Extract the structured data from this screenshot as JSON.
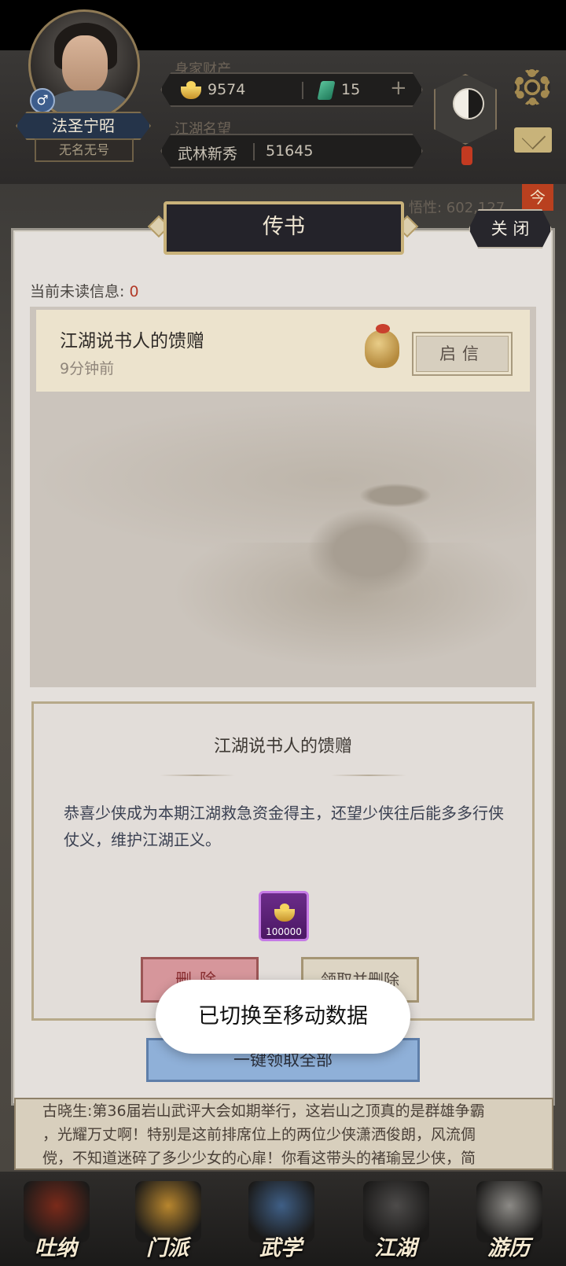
{
  "header": {
    "player_name": "法圣宁昭",
    "player_title": "无名无号",
    "gender_symbol": "♂",
    "wealth_label": "身家财产",
    "gold": "9574",
    "jade": "15",
    "plus_symbol": "+",
    "reputation_label": "江湖名望",
    "rank": "武林新秀",
    "reputation_value": "51645",
    "wuxing_text": "悟性: 602,127",
    "corner_badge": "今"
  },
  "modal": {
    "title": "传书",
    "close_label": "关 闭",
    "unread_label": "当前未读信息:",
    "unread_count": "0",
    "mail_items": [
      {
        "title": "江湖说书人的馈赠",
        "time": "9分钟前",
        "open_label": "启信"
      }
    ],
    "detail": {
      "title": "江湖说书人的馈赠",
      "body": "恭喜少侠成为本期江湖救急资金得主，还望少侠往后能多多行侠仗义，维护江湖正义。",
      "reward_amount": "100000",
      "delete_label": "删除",
      "claim_label": "领取并删除"
    },
    "claim_all_label": "一键领取全部"
  },
  "toast": "已切换至移动数据",
  "news": {
    "line1": "古晓生:第36届岩山武评大会如期举行，这岩山之顶真的是群雄争霸",
    "line2": "，光耀万丈啊！特别是这前排席位上的两位少侠潇洒俊朗，风流倜",
    "line3": "傥，不知道迷碎了多少少女的心扉！你看这带头的褚瑜昱少侠，简"
  },
  "bottom_nav": [
    {
      "label": "吐纳",
      "icon": "gourd-icon",
      "color": "#7a2a1a"
    },
    {
      "label": "门派",
      "icon": "banner-icon",
      "color": "#b8862e"
    },
    {
      "label": "武学",
      "icon": "book-icon",
      "color": "#3f5f86"
    },
    {
      "label": "江湖",
      "icon": "hat-icon",
      "color": "#4d4b4a"
    },
    {
      "label": "游历",
      "icon": "horse-icon",
      "color": "#8c8a86"
    }
  ]
}
